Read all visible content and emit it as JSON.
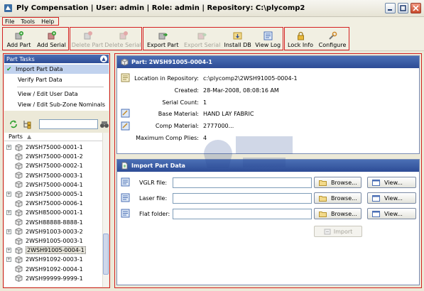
{
  "window": {
    "title": "Ply Compensation  |  User: admin  |  Role: admin  |  Repository: C:\\plycomp2"
  },
  "menu": [
    "File",
    "Tools",
    "Help"
  ],
  "toolbar": {
    "groups": [
      [
        {
          "label": "Add Part",
          "icon": "add-part-icon",
          "enabled": true
        },
        {
          "label": "Add Serial",
          "icon": "add-serial-icon",
          "enabled": true
        }
      ],
      [
        {
          "label": "Delete Part",
          "icon": "delete-part-icon",
          "enabled": false
        },
        {
          "label": "Delete Serial",
          "icon": "delete-serial-icon",
          "enabled": false
        }
      ],
      [
        {
          "label": "Export Part",
          "icon": "export-part-icon",
          "enabled": true
        },
        {
          "label": "Export Serial",
          "icon": "export-serial-icon",
          "enabled": false
        },
        {
          "label": "Install DB",
          "icon": "install-db-icon",
          "enabled": true
        },
        {
          "label": "View Log",
          "icon": "view-log-icon",
          "enabled": true
        }
      ],
      [
        {
          "label": "Lock Info",
          "icon": "lock-icon",
          "enabled": true
        },
        {
          "label": "Configure",
          "icon": "configure-icon",
          "enabled": true
        }
      ]
    ]
  },
  "tasks": {
    "title": "Part Tasks",
    "items": [
      "Import Part Data",
      "Verify Part Data",
      "View / Edit User Data",
      "View / Edit Sub-Zone Nominals"
    ],
    "active_index": 0
  },
  "tree": {
    "header": "Parts",
    "items": [
      {
        "label": "2WSH75000-0001-1",
        "expandable": true
      },
      {
        "label": "2WSH75000-0001-2",
        "expandable": false
      },
      {
        "label": "2WSH75000-0002-1",
        "expandable": false
      },
      {
        "label": "2WSH75000-0003-1",
        "expandable": false
      },
      {
        "label": "2WSH75000-0004-1",
        "expandable": false
      },
      {
        "label": "2WSH75000-0005-1",
        "expandable": true
      },
      {
        "label": "2WSH75000-0006-1",
        "expandable": false
      },
      {
        "label": "2WSH85000-0001-1",
        "expandable": true
      },
      {
        "label": "2WSH88888-8888-1",
        "expandable": false
      },
      {
        "label": "2WSH91003-0003-2",
        "expandable": true
      },
      {
        "label": "2WSH91005-0003-1",
        "expandable": false
      },
      {
        "label": "2WSH91005-0004-1",
        "expandable": true
      },
      {
        "label": "2WSH91092-0003-1",
        "expandable": true
      },
      {
        "label": "2WSH91092-0004-1",
        "expandable": false
      },
      {
        "label": "2WSH99999-9999-1",
        "expandable": false
      }
    ],
    "selected_index": 11
  },
  "part": {
    "header": "Part: 2WSH91005-0004-1",
    "fields": [
      {
        "label": "Location in Repository:",
        "value": "c:\\plycomp2\\2WSH91005-0004-1"
      },
      {
        "label": "Created:",
        "value": "28-Mar-2008, 08:08:16 AM"
      },
      {
        "label": "Serial Count:",
        "value": "1"
      },
      {
        "label": "Base Material:",
        "value": "HAND LAY FABRIC"
      },
      {
        "label": "Comp Material:",
        "value": "2777000..."
      },
      {
        "label": "Maximum Comp Plies:",
        "value": "4"
      }
    ]
  },
  "import": {
    "header": "Import Part Data",
    "rows": [
      {
        "label": "VGLR file:",
        "value": "",
        "browse": "Browse...",
        "view": "View..."
      },
      {
        "label": "Laser file:",
        "value": "",
        "browse": "Browse...",
        "view": "View..."
      },
      {
        "label": "Flat folder:",
        "value": "",
        "browse": "Browse...",
        "view": "View..."
      }
    ],
    "button": "Import"
  },
  "colors": {
    "panel_header": "#2D4C96",
    "highlight_outline": "#D42020",
    "window_bg": "#ECE9D8"
  }
}
